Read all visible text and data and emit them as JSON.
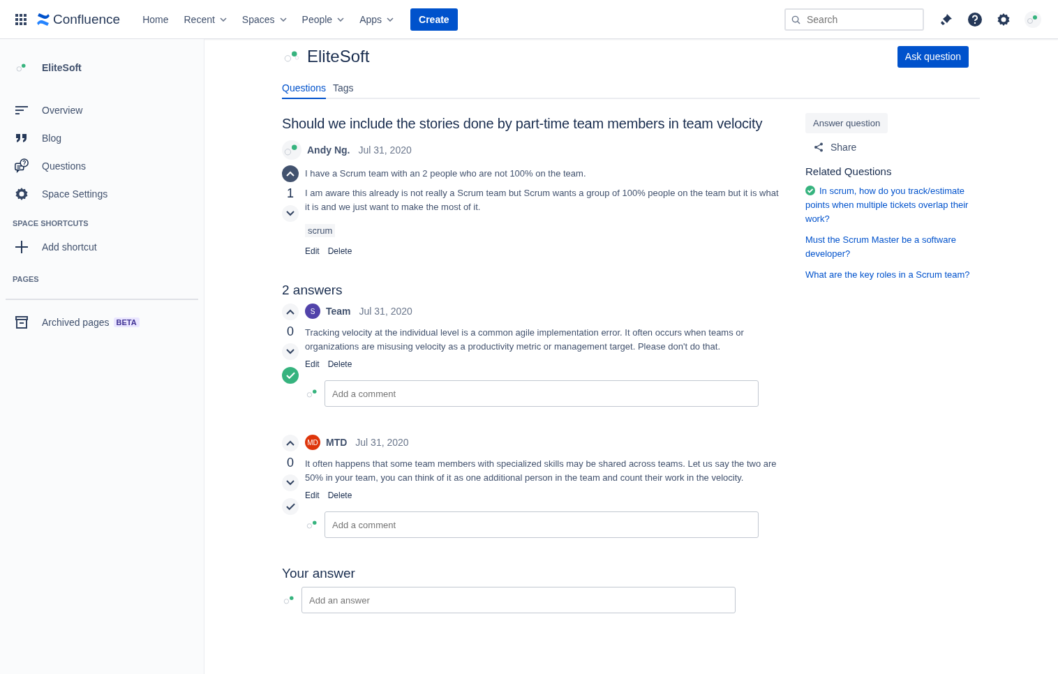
{
  "nav": {
    "app_name": "Confluence",
    "items": [
      {
        "label": "Home",
        "dropdown": false
      },
      {
        "label": "Recent",
        "dropdown": true
      },
      {
        "label": "Spaces",
        "dropdown": true
      },
      {
        "label": "People",
        "dropdown": true
      },
      {
        "label": "Apps",
        "dropdown": true
      }
    ],
    "create": "Create",
    "search": {
      "placeholder": "Search"
    }
  },
  "sidebar": {
    "space_name": "EliteSoft",
    "items": [
      {
        "label": "Overview",
        "kind": "overview"
      },
      {
        "label": "Blog",
        "kind": "blog"
      },
      {
        "label": "Questions",
        "kind": "questions"
      },
      {
        "label": "Space Settings",
        "kind": "settings"
      }
    ],
    "shortcuts_heading": "SPACE SHORTCUTS",
    "add_shortcut": "Add shortcut",
    "pages_heading": "PAGES",
    "archived": {
      "label": "Archived pages",
      "badge": "BETA"
    }
  },
  "space": {
    "title": "EliteSoft",
    "ask_button": "Ask question",
    "tabs": [
      {
        "label": "Questions",
        "selected": true
      },
      {
        "label": "Tags",
        "selected": false
      }
    ]
  },
  "question": {
    "title": "Should we include the stories done by part-time team members in team velocity",
    "author": "Andy Ng.",
    "date": "Jul 31, 2020",
    "votes": "1",
    "upvoted": true,
    "paragraphs": [
      "I have a Scrum team with an 2 people who are not 100% on the team.",
      "I am aware this already is not really a Scrum team but Scrum wants a group of 100% people on the team but it is what it is and we just want to make the most of it."
    ],
    "tags": [
      "scrum"
    ],
    "actions": [
      "Edit",
      "Delete"
    ]
  },
  "answers_heading": "2 answers",
  "answers": [
    {
      "avatar": "S",
      "color": "#5243aa",
      "author": "Team",
      "date": "Jul 31, 2020",
      "votes": "0",
      "accepted": true,
      "text": "Tracking velocity at the individual level is a common agile implementation error. It often occurs when teams or organizations are misusing velocity as a productivity metric or management target. Please don't do that.",
      "actions": [
        "Edit",
        "Delete"
      ],
      "comment_placeholder": "Add a comment"
    },
    {
      "avatar": "MD",
      "color": "#de350b",
      "author": "MTD",
      "date": "Jul 31, 2020",
      "votes": "0",
      "accepted": false,
      "text": "It often happens that some team members with specialized skills may be shared across teams. Let us say the two are 50% in your team, you can think of it as one additional person in the team and count their work in the velocity.",
      "actions": [
        "Edit",
        "Delete"
      ],
      "comment_placeholder": "Add a comment"
    }
  ],
  "your_answer": {
    "heading": "Your answer",
    "placeholder": "Add an answer"
  },
  "side": {
    "answer_button": "Answer question",
    "share": "Share",
    "related_heading": "Related Questions",
    "related": [
      {
        "text": "In scrum, how do you track/estimate points when multiple tickets overlap their work?",
        "solved": true
      },
      {
        "text": "Must the Scrum Master be a software developer?",
        "solved": false
      },
      {
        "text": "What are the key roles in a Scrum team?",
        "solved": false
      }
    ]
  }
}
